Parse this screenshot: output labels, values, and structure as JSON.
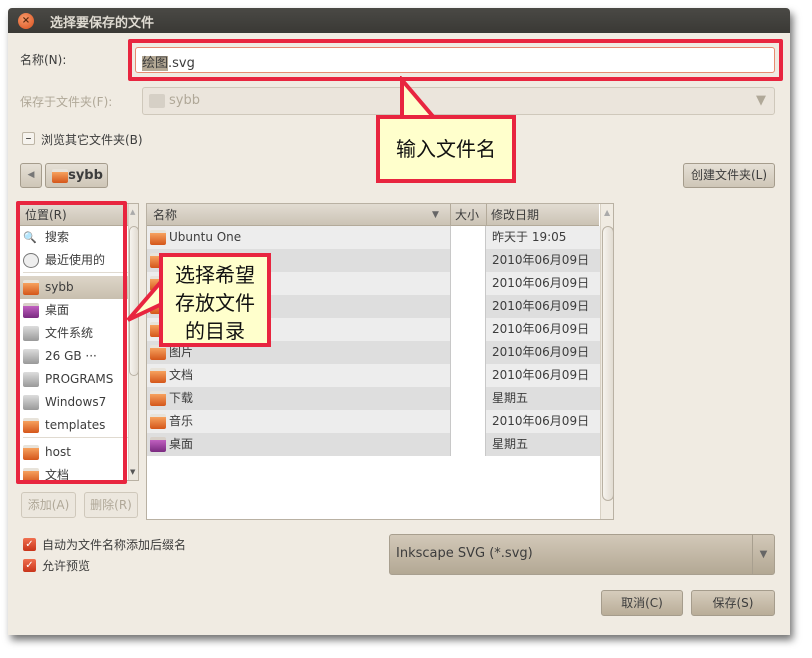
{
  "window": {
    "title": "选择要保存的文件"
  },
  "name_field": {
    "label": "名称(N):",
    "value_selected": "绘图",
    "value_ext": ".svg"
  },
  "save_in": {
    "label": "保存于文件夹(F):",
    "value": "sybb"
  },
  "browse_expander": {
    "label": "浏览其它文件夹(B)"
  },
  "path_bar": {
    "current": "sybb"
  },
  "create_folder_button": "创建文件夹(L)",
  "places": {
    "header": "位置(R)",
    "items": [
      {
        "label": "搜索",
        "icon": "search-icon"
      },
      {
        "label": "最近使用的",
        "icon": "clock-icon"
      },
      {
        "label": "sybb",
        "icon": "home-folder-icon",
        "selected": true
      },
      {
        "label": "桌面",
        "icon": "desktop-icon"
      },
      {
        "label": "文件系统",
        "icon": "drive-icon"
      },
      {
        "label": "26 GB ···",
        "icon": "drive-icon"
      },
      {
        "label": "PROGRAMS",
        "icon": "drive-icon"
      },
      {
        "label": "Windows7",
        "icon": "drive-icon"
      },
      {
        "label": "templates",
        "icon": "folder-icon"
      },
      {
        "label": "host",
        "icon": "folder-icon"
      },
      {
        "label": "文档",
        "icon": "documents-folder-icon"
      }
    ],
    "add_button": "添加(A)",
    "remove_button": "删除(R)"
  },
  "files": {
    "columns": [
      "名称",
      "大小",
      "修改日期"
    ],
    "rows": [
      {
        "name": "Ubuntu One",
        "size": "",
        "modified": "昨天于 19:05"
      },
      {
        "name": "",
        "size": "",
        "modified": "2010年06月09日"
      },
      {
        "name": "",
        "size": "",
        "modified": "2010年06月09日"
      },
      {
        "name": "",
        "size": "",
        "modified": "2010年06月09日"
      },
      {
        "name": "",
        "size": "",
        "modified": "2010年06月09日"
      },
      {
        "name": "图片",
        "size": "",
        "modified": "2010年06月09日"
      },
      {
        "name": "文档",
        "size": "",
        "modified": "2010年06月09日"
      },
      {
        "name": "下载",
        "size": "",
        "modified": "星期五"
      },
      {
        "name": "音乐",
        "size": "",
        "modified": "2010年06月09日"
      },
      {
        "name": "桌面",
        "size": "",
        "modified": "星期五"
      }
    ]
  },
  "options": {
    "auto_extension": {
      "label": "自动为文件名称添加后缀名",
      "checked": true
    },
    "allow_preview": {
      "label": "允许预览",
      "checked": true
    }
  },
  "filter": {
    "value": "Inkscape SVG (*.svg)"
  },
  "cancel_button": "取消(C)",
  "save_button": "保存(S)",
  "annotations": {
    "name_callout": "输入文件名",
    "dir_callout_lines": [
      "选择希望",
      "存放文件",
      "的目录"
    ]
  },
  "colors": {
    "annotation_red": "#e8253f",
    "callout_bg": "#ffffcc",
    "titlebar": "#3c3b37",
    "dialog_bg": "#f0ebe2"
  }
}
